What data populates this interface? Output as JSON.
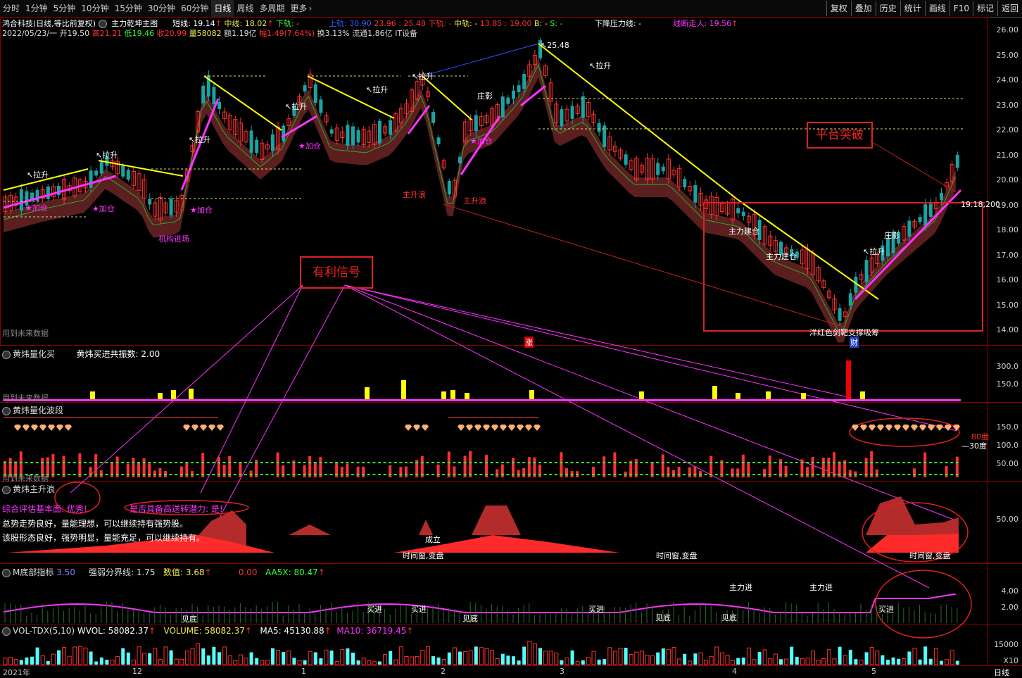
{
  "toolbar": {
    "tabs": [
      "分时",
      "1分钟",
      "5分钟",
      "10分钟",
      "15分钟",
      "30分钟",
      "60分钟",
      "日线",
      "周线",
      "多周期",
      "更多"
    ],
    "active_tab": "日线",
    "right_buttons": [
      "复权",
      "叠加",
      "历史",
      "统计",
      "画线",
      "F10",
      "标记",
      "返回"
    ]
  },
  "header": {
    "stock_name": "鸿合科技(日线,等比前复权)",
    "indicator": "主力乾坤主图",
    "short_line": "短线: 19.14",
    "mid_line": "中线: 18.02",
    "down_label": "下轨: -",
    "upper_rail": "上轨: 30.90",
    "vals1": "23.96 : 25.48",
    "lower_rail": "下轨: -",
    "mid_rail": "中轨: -",
    "vals2": "13.85 : 19.00",
    "b_label": "B: -",
    "s_label": "S: -",
    "pressure": "下降压力线: -",
    "linebreak": "线断走人: 19.56",
    "date": "2022/05/23/一",
    "open": "开19.50",
    "high": "高21.21",
    "low": "低19.46",
    "close": "收20.99",
    "vol": "量58082",
    "amount": "额1.19亿",
    "change": "幅1.49(7.64%)",
    "turnover": "换3.13%",
    "float": "流通1.86亿",
    "industry": "IT设备"
  },
  "main_axis": [
    "26.00",
    "25.00",
    "24.00",
    "23.00",
    "22.00",
    "21.00",
    "20.00",
    "19.00",
    "18.00",
    "17.00",
    "16.00",
    "15.00",
    "14.00"
  ],
  "annotations": {
    "peak": "25.48",
    "platform_break": "平台突破",
    "favorable_signal": "有利信号",
    "price_1918": "19.18",
    "price_200": "200",
    "future_data": "用到未来数据",
    "institution": "机构进场",
    "main_rise": "主升浪",
    "rebound": "反弹",
    "pullup": "拉升",
    "addpos": "★加仓",
    "buildpos": "主力建仓",
    "zhuangying": "庄影",
    "bottom_text": "洋红色剑靶支撑吸筹",
    "cai": "财",
    "zhang": "涨"
  },
  "panel1": {
    "title": "黄炜量化买",
    "info": "黄炜买进共振数: 2.00",
    "axis": [
      "300.0",
      "150.0"
    ]
  },
  "panel2": {
    "title": "黄炜量化波段",
    "axis": [
      "150.0",
      "100.0",
      "50.00"
    ],
    "labels": [
      "—30度",
      "80度"
    ]
  },
  "panel3": {
    "title": "黄炜主升浪",
    "line1": "综合评估基本面: 优秀!",
    "line1b": "是否具备高送转潜力: 是!",
    "line2": "总势走势良好，量能理想，可以继续持有强势股。",
    "line3": "该股形态良好，强势明显，量能充足，可以继续持有。",
    "axis": [
      "50.00"
    ],
    "window": "时间窗,变盘",
    "chengli": "成立"
  },
  "panel4": {
    "title": "M底部指标",
    "v1": "3.50",
    "weak_line": "强弱分界线: 1.75",
    "value": "数值: 3.68",
    "v2": "0.00",
    "aa5x": "AA5X: 80.47",
    "axis": [
      "4.00",
      "2.00"
    ],
    "mainin": "主力进",
    "buy": "买进",
    "seebottom": "见底"
  },
  "panel5": {
    "title": "VOL-TDX(5,10)",
    "wvol": "WVOL: 58082.37",
    "volume": "VOLUME: 58082.37",
    "ma5": "MA5: 45130.88",
    "ma10": "MA10: 36719.45",
    "axis": [
      "15000"
    ],
    "unit": "X10"
  },
  "dates": [
    "2021年",
    "12",
    "1",
    "2",
    "3",
    "4",
    "5",
    "日线"
  ],
  "colors": {
    "up": "#ff3232",
    "down": "#54ffff",
    "yellow": "#ffff00",
    "magenta": "#ff32ff",
    "green": "#32ff32",
    "bg": "#000000"
  }
}
